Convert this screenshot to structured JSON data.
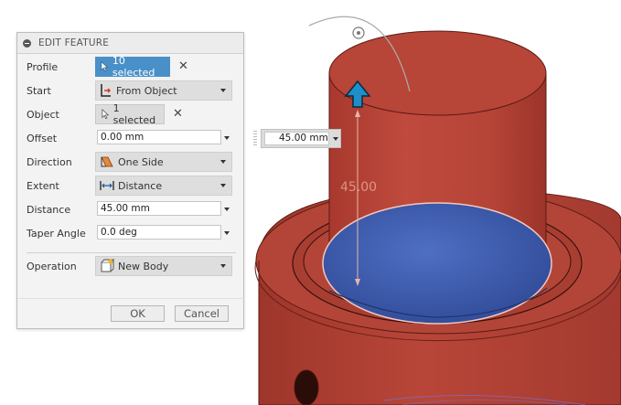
{
  "panel": {
    "title": "EDIT FEATURE",
    "rows": {
      "profile": {
        "label": "Profile",
        "value": "10 selected"
      },
      "start": {
        "label": "Start",
        "value": "From Object"
      },
      "object": {
        "label": "Object",
        "value": "1 selected"
      },
      "offset": {
        "label": "Offset",
        "value": "0.00 mm"
      },
      "direction": {
        "label": "Direction",
        "value": "One Side"
      },
      "extent": {
        "label": "Extent",
        "value": "Distance"
      },
      "distance": {
        "label": "Distance",
        "value": "45.00 mm"
      },
      "taper": {
        "label": "Taper Angle",
        "value": "0.0 deg"
      },
      "operation": {
        "label": "Operation",
        "value": "New Body"
      }
    },
    "ok_label": "OK",
    "cancel_label": "Cancel"
  },
  "viewport": {
    "distance_input": "45.00 mm",
    "ghost_dimension": "45.00"
  },
  "icons": {
    "clear": "✕"
  },
  "colors": {
    "accent": "#4a90c8",
    "model": "#b54a3d",
    "profile_face": "#3a5aa8",
    "arrow": "#1e8fc8"
  }
}
